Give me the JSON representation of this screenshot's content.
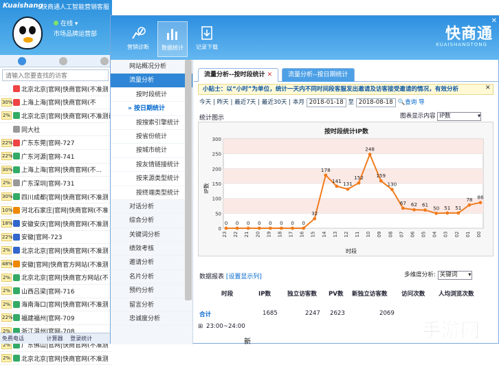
{
  "app": {
    "logo": "Kuaishang",
    "title": "快商通人工智能营销客服",
    "status": "在线",
    "dept": "市场品牌运营部",
    "close": "✕"
  },
  "search": {
    "placeholder": "请输入您要查找的访客"
  },
  "visitors": [
    {
      "badge": "",
      "text": "北京北京|官网|快商官网(不准测",
      "color": "#e44"
    },
    {
      "badge": "30%",
      "text": "上海上海|官网|快商官网(不",
      "color": "#e44"
    },
    {
      "badge": "2%",
      "text": "北京北京|官网|快商官网(不准测试-",
      "color": "#3a6"
    },
    {
      "badge": "",
      "text": "同大社",
      "color": "#999"
    },
    {
      "badge": "22%",
      "text": "广东东莞|官网-727",
      "color": "#e44"
    },
    {
      "badge": "22%",
      "text": "广东河源|官网-741",
      "color": "#3a6"
    },
    {
      "badge": "30%",
      "text": "上海上海|官网|快商官网(不...",
      "color": "#3a6"
    },
    {
      "badge": "2%",
      "text": "广东深圳|官网-731",
      "color": "#999"
    },
    {
      "badge": "30%",
      "text": "四川成都|官网|快商官网(不准测",
      "color": "#3a6"
    },
    {
      "badge": "10%",
      "text": "河北石家庄|官网|快商官网(不准",
      "color": "#e80"
    },
    {
      "badge": "18%",
      "text": "安徽安庆|官网|快商官网(不准测",
      "color": "#36c"
    },
    {
      "badge": "22%",
      "text": "安徽|官网-723",
      "color": "#36c"
    },
    {
      "badge": "2%",
      "text": "北京北京|官网|快商官网(不准测",
      "color": "#36c"
    },
    {
      "badge": "48%",
      "text": "安徽|官网|快商官方网站(不准测",
      "color": "#e80"
    },
    {
      "badge": "2%",
      "text": "北京北京|官网|快商官方网站(不",
      "color": "#3a6"
    },
    {
      "badge": "2%",
      "text": "山西吕梁|官网-716",
      "color": "#3a6"
    },
    {
      "badge": "2%",
      "text": "海南海口|官网|快商官网(不准测",
      "color": "#3a6"
    },
    {
      "badge": "22%",
      "text": "福建福州|官网-709",
      "color": "#3a6"
    },
    {
      "badge": "2%",
      "text": "浙江温州|官网-708",
      "color": "#3a6"
    },
    {
      "badge": "2%",
      "text": "广东佛山|官网|快商官网(不准测",
      "color": "#3a6"
    },
    {
      "badge": "2%",
      "text": "北京北京|官网|快商官网(不准测",
      "color": "#3a6"
    }
  ],
  "bottom": {
    "b1": "免费电话",
    "b2": "计算器",
    "b3": "登录统计"
  },
  "toolbar": [
    {
      "label": "营销诊断"
    },
    {
      "label": "数据统计"
    },
    {
      "label": "记录下载"
    }
  ],
  "brand": {
    "name": "快商通",
    "sub": "KUAISHANGTONG"
  },
  "nav": {
    "items": [
      "网站概况分析",
      "流量分析",
      "按时段统计",
      "按日期统计",
      "按搜索引擎统计",
      "按省份统计",
      "按城市统计",
      "按友情链接统计",
      "按来源类型统计",
      "按终端类型统计",
      "对话分析",
      "综合分析",
      "关键词分析",
      "绩效考核",
      "邀请分析",
      "名片分析",
      "预约分析",
      "留言分析",
      "忠诚度分析"
    ]
  },
  "tabs": {
    "t1": "流量分析--按时段统计",
    "t2": "流量分析--按日期统计"
  },
  "tip": "小贴士：以“小时”为单位，统计一天内不同时间段客服发出邀请及访客接受邀请的情况，有效分析",
  "filters": {
    "today": "今天",
    "yesterday": "昨天",
    "last7": "最近7天",
    "last30": "最近30天",
    "month": "本月",
    "from": "2018-01-18",
    "to_label": "至",
    "to": "2018-08-18",
    "query": "查询",
    "export": "导"
  },
  "chart_section": {
    "label": "统计图示",
    "content_label": "图表显示内容",
    "content_value": "IP数"
  },
  "chart_data": {
    "type": "line",
    "title": "按时段统计IP数",
    "xlabel": "时段",
    "ylabel": "IP数",
    "ylim": [
      0,
      300
    ],
    "yticks": [
      0,
      50,
      100,
      150,
      200,
      250,
      300
    ],
    "categories": [
      "23",
      "22",
      "21",
      "20",
      "19",
      "18",
      "17",
      "16",
      "15",
      "14",
      "13",
      "12",
      "11",
      "10",
      "09",
      "08",
      "07",
      "06",
      "05",
      "04",
      "03",
      "02",
      "01",
      "00"
    ],
    "values": [
      0,
      0,
      0,
      0,
      0,
      0,
      0,
      0,
      32,
      178,
      141,
      131,
      152,
      248,
      159,
      130,
      67,
      62,
      61,
      50,
      51,
      51,
      78,
      86
    ],
    "color": "#f07b1c"
  },
  "report": {
    "label": "数据报表",
    "config": "[设置显示列]",
    "multi_label": "多维度分析:",
    "multi_value": "关键词"
  },
  "table": {
    "headers": [
      "时段",
      "IP数",
      "独立访客数",
      "PV数",
      "新独立访客数",
      "访问次数",
      "人均浏览次数"
    ],
    "total_label": "合计",
    "total": [
      "1685",
      "2247",
      "2623",
      "2069"
    ],
    "row1": "23:00~24:00"
  },
  "overlay": {
    "new": "新",
    "watermark": "手游网"
  }
}
